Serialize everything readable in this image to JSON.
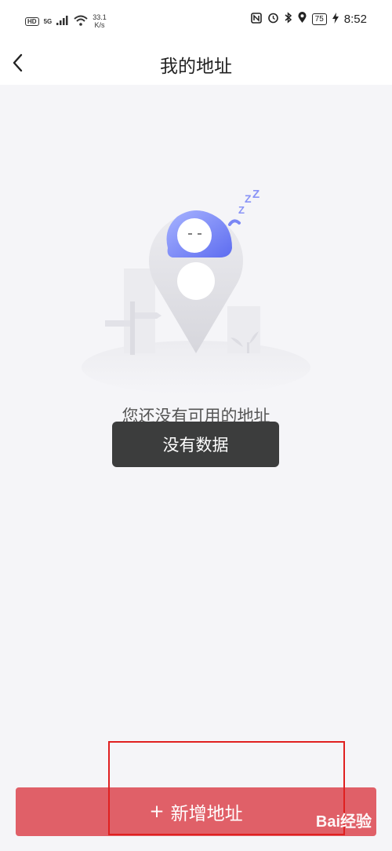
{
  "status_bar": {
    "hd_badge": "HD",
    "signal": "5G",
    "net_speed_value": "33.1",
    "net_speed_unit": "K/s",
    "battery": "75",
    "time": "8:52"
  },
  "header": {
    "title": "我的地址"
  },
  "empty_state": {
    "message": "您还没有可用的地址"
  },
  "toast": {
    "text": "没有数据"
  },
  "footer": {
    "add_button_plus": "+",
    "add_button_label": "新增地址"
  },
  "watermark": {
    "text": "Bai经验"
  },
  "colors": {
    "button": "#e06068",
    "toast_bg": "#3c3d3d",
    "page_bg": "#f5f5f8",
    "highlight_box": "#e02020"
  }
}
